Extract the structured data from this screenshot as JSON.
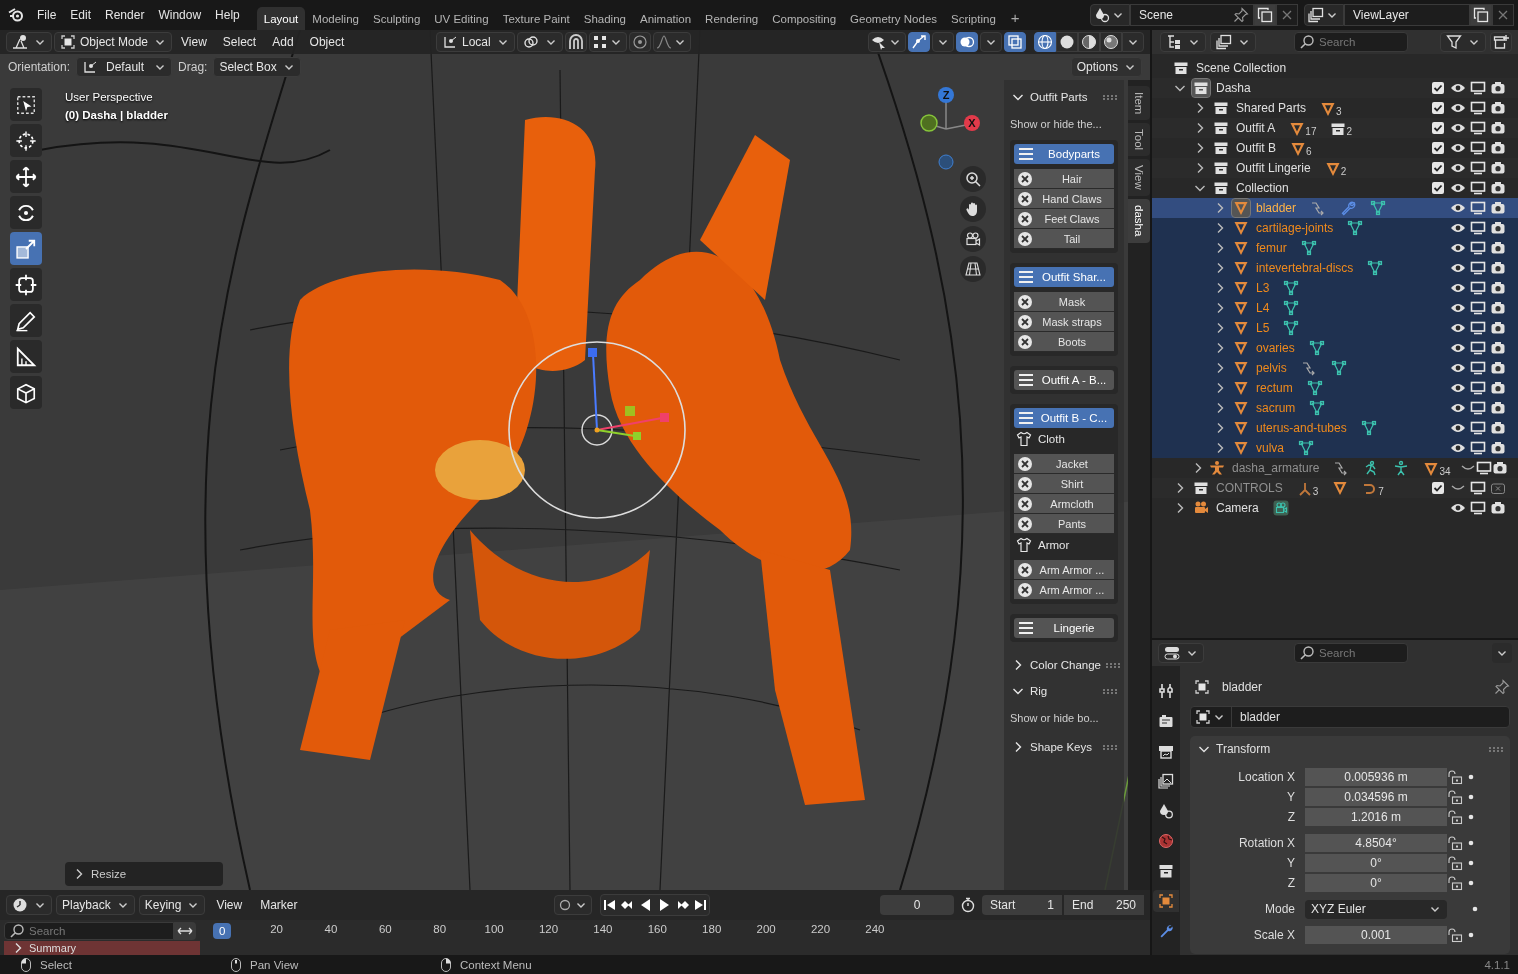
{
  "menu_bar": {
    "menus": [
      "File",
      "Edit",
      "Render",
      "Window",
      "Help"
    ],
    "workspaces": [
      {
        "label": "Layout",
        "selected": true
      },
      {
        "label": "Modeling",
        "selected": false
      },
      {
        "label": "Sculpting",
        "selected": false
      },
      {
        "label": "UV Editing",
        "selected": false
      },
      {
        "label": "Texture Paint",
        "selected": false
      },
      {
        "label": "Shading",
        "selected": false
      },
      {
        "label": "Animation",
        "selected": false
      },
      {
        "label": "Rendering",
        "selected": false
      },
      {
        "label": "Compositing",
        "selected": false
      },
      {
        "label": "Geometry Nodes",
        "selected": false
      },
      {
        "label": "Scripting",
        "selected": false
      }
    ],
    "add_workspace": "+",
    "scene": "Scene",
    "view_layer": "ViewLayer"
  },
  "viewport": {
    "header": {
      "mode": "Object Mode",
      "menus": [
        "View",
        "Select",
        "Add",
        "Object"
      ],
      "transform_orientation": "Local",
      "toggles": [
        {
          "kind": "snap",
          "on": false
        },
        {
          "kind": "proportional",
          "on": false
        },
        {
          "kind": "gizmos",
          "on": true
        },
        {
          "kind": "overlays",
          "on": true
        },
        {
          "kind": "xray",
          "on": true
        }
      ],
      "shading": [
        {
          "kind": "wireframe",
          "selected": true
        },
        {
          "kind": "solid",
          "selected": false
        },
        {
          "kind": "material",
          "selected": false
        },
        {
          "kind": "rendered",
          "selected": false
        }
      ]
    },
    "tool_settings": {
      "orientation_label": "Orientation:",
      "orientation": "Default",
      "drag_label": "Drag:",
      "drag": "Select Box",
      "options": "Options"
    },
    "tools": [
      {
        "kind": "select",
        "selected": false
      },
      {
        "kind": "cursor",
        "selected": false
      },
      {
        "kind": "move",
        "selected": false
      },
      {
        "kind": "rotate",
        "selected": false
      },
      {
        "kind": "scale",
        "selected": true
      },
      {
        "kind": "transform",
        "selected": false
      },
      {
        "kind": "annotate",
        "selected": false
      },
      {
        "kind": "measure",
        "selected": false
      },
      {
        "kind": "add_cube",
        "selected": false
      }
    ],
    "info": [
      "User Perspective",
      "(0) Dasha | bladder"
    ],
    "nav_gizmo": {
      "labels": [
        "Z",
        "X"
      ]
    },
    "last_operator": "Resize",
    "sidebar": {
      "tabs": [
        {
          "label": "Item",
          "selected": false
        },
        {
          "label": "Tool",
          "selected": false
        },
        {
          "label": "View",
          "selected": false
        },
        {
          "label": "dasha",
          "selected": true
        }
      ],
      "panels": [
        {
          "title": "Outfit Parts",
          "expanded": true,
          "description": "Show or hide the...",
          "groups": [
            {
              "header": "Bodyparts",
              "on": true,
              "items": [
                {
                  "kind": "toggle",
                  "label": "Hair"
                },
                {
                  "kind": "toggle",
                  "label": "Hand Claws"
                },
                {
                  "kind": "toggle",
                  "label": "Feet Claws"
                },
                {
                  "kind": "toggle",
                  "label": "Tail"
                }
              ]
            },
            {
              "header": "Outfit Shar...",
              "on": true,
              "items": [
                {
                  "kind": "toggle",
                  "label": "Mask"
                },
                {
                  "kind": "toggle",
                  "label": "Mask straps"
                },
                {
                  "kind": "toggle",
                  "label": "Boots"
                }
              ]
            },
            {
              "header": "Outfit A - B...",
              "on": false
            },
            {
              "header": "Outfit B - C...",
              "on": true,
              "items": [
                {
                  "kind": "heading",
                  "label": "Cloth"
                },
                {
                  "kind": "toggle",
                  "label": "Jacket"
                },
                {
                  "kind": "toggle",
                  "label": "Shirt"
                },
                {
                  "kind": "toggle",
                  "label": "Armcloth"
                },
                {
                  "kind": "toggle",
                  "label": "Pants"
                },
                {
                  "kind": "heading",
                  "label": "Armor"
                },
                {
                  "kind": "toggle",
                  "label": "Arm Armor ..."
                },
                {
                  "kind": "toggle",
                  "label": "Arm Armor ..."
                }
              ]
            },
            {
              "header": "Lingerie",
              "on": false
            }
          ]
        },
        {
          "title": "Color Change",
          "expanded": false
        },
        {
          "title": "Rig",
          "expanded": true,
          "description": "Show or hide bo..."
        },
        {
          "title": "Shape Keys",
          "expanded": false
        }
      ]
    }
  },
  "outliner": {
    "search_placeholder": "Search",
    "tree": {
      "name": "Scene Collection",
      "children": [
        {
          "name": "Dasha",
          "kind": "collection",
          "expanded": true,
          "checked": true,
          "visible": true,
          "renderable": true,
          "selected": false,
          "active": true,
          "children": [
            {
              "name": "Shared Parts",
              "kind": "collection",
              "expanded": false,
              "checked": true,
              "visible": true,
              "renderable": true,
              "selected": false,
              "active": false,
              "badges": [
                {
                  "kind": "mesh",
                  "count": "3"
                }
              ]
            },
            {
              "name": "Outfit A",
              "kind": "collection",
              "expanded": false,
              "checked": true,
              "visible": true,
              "renderable": true,
              "selected": false,
              "active": false,
              "badges": [
                {
                  "kind": "mesh",
                  "count": "17"
                },
                {
                  "kind": "collection",
                  "count": "2"
                }
              ]
            },
            {
              "name": "Outfit B",
              "kind": "collection",
              "expanded": false,
              "checked": true,
              "visible": true,
              "renderable": true,
              "selected": false,
              "active": false,
              "badges": [
                {
                  "kind": "mesh",
                  "count": "6"
                }
              ]
            },
            {
              "name": "Outfit Lingerie",
              "kind": "collection",
              "expanded": false,
              "checked": true,
              "visible": true,
              "renderable": true,
              "selected": false,
              "active": false,
              "badges": [
                {
                  "kind": "mesh",
                  "count": "2"
                }
              ]
            },
            {
              "name": "Collection",
              "kind": "collection",
              "expanded": true,
              "checked": true,
              "visible": true,
              "renderable": true,
              "selected": false,
              "active": false,
              "children": [
                {
                  "name": "bladder",
                  "kind": "mesh",
                  "expanded": false,
                  "visible": true,
                  "renderable": true,
                  "selected": true,
                  "active": true,
                  "badges": [
                    {
                      "kind": "hook"
                    },
                    {
                      "kind": "modifier"
                    },
                    {
                      "kind": "mesh_data"
                    }
                  ]
                },
                {
                  "name": "cartilage-joints",
                  "kind": "mesh",
                  "expanded": false,
                  "visible": true,
                  "renderable": true,
                  "selected": true,
                  "active": false,
                  "badges": [
                    {
                      "kind": "mesh_data"
                    }
                  ]
                },
                {
                  "name": "femur",
                  "kind": "mesh",
                  "expanded": false,
                  "visible": true,
                  "renderable": true,
                  "selected": true,
                  "active": false,
                  "badges": [
                    {
                      "kind": "mesh_data"
                    }
                  ]
                },
                {
                  "name": "intevertebral-discs",
                  "kind": "mesh",
                  "expanded": false,
                  "visible": true,
                  "renderable": true,
                  "selected": true,
                  "active": false,
                  "badges": [
                    {
                      "kind": "mesh_data"
                    }
                  ]
                },
                {
                  "name": "L3",
                  "kind": "mesh",
                  "expanded": false,
                  "visible": true,
                  "renderable": true,
                  "selected": true,
                  "active": false,
                  "badges": [
                    {
                      "kind": "mesh_data"
                    }
                  ]
                },
                {
                  "name": "L4",
                  "kind": "mesh",
                  "expanded": false,
                  "visible": true,
                  "renderable": true,
                  "selected": true,
                  "active": false,
                  "badges": [
                    {
                      "kind": "mesh_data"
                    }
                  ]
                },
                {
                  "name": "L5",
                  "kind": "mesh",
                  "expanded": false,
                  "visible": true,
                  "renderable": true,
                  "selected": true,
                  "active": false,
                  "badges": [
                    {
                      "kind": "mesh_data"
                    }
                  ]
                },
                {
                  "name": "ovaries",
                  "kind": "mesh",
                  "expanded": false,
                  "visible": true,
                  "renderable": true,
                  "selected": true,
                  "active": false,
                  "badges": [
                    {
                      "kind": "mesh_data"
                    }
                  ]
                },
                {
                  "name": "pelvis",
                  "kind": "mesh",
                  "expanded": false,
                  "visible": true,
                  "renderable": true,
                  "selected": true,
                  "active": false,
                  "badges": [
                    {
                      "kind": "hook"
                    },
                    {
                      "kind": "mesh_data"
                    }
                  ]
                },
                {
                  "name": "rectum",
                  "kind": "mesh",
                  "expanded": false,
                  "visible": true,
                  "renderable": true,
                  "selected": true,
                  "active": false,
                  "badges": [
                    {
                      "kind": "mesh_data"
                    }
                  ]
                },
                {
                  "name": "sacrum",
                  "kind": "mesh",
                  "expanded": false,
                  "visible": true,
                  "renderable": true,
                  "selected": true,
                  "active": false,
                  "badges": [
                    {
                      "kind": "mesh_data"
                    }
                  ]
                },
                {
                  "name": "uterus-and-tubes",
                  "kind": "mesh",
                  "expanded": false,
                  "visible": true,
                  "renderable": true,
                  "selected": true,
                  "active": false,
                  "badges": [
                    {
                      "kind": "mesh_data"
                    }
                  ]
                },
                {
                  "name": "vulva",
                  "kind": "mesh",
                  "expanded": false,
                  "visible": true,
                  "renderable": true,
                  "selected": true,
                  "active": false,
                  "badges": [
                    {
                      "kind": "mesh_data"
                    }
                  ]
                }
              ]
            },
            {
              "name": "dasha_armature",
              "kind": "armature",
              "expanded": false,
              "visible": false,
              "renderable": true,
              "selected": false,
              "active": false,
              "badges": [
                {
                  "kind": "hook"
                },
                {
                  "kind": "pose"
                },
                {
                  "kind": "armature_data"
                },
                {
                  "kind": "mesh",
                  "count": "34"
                }
              ]
            }
          ]
        },
        {
          "name": "CONTROLS",
          "kind": "collection",
          "expanded": false,
          "checked": true,
          "visible": false,
          "renderable": false,
          "selected": false,
          "active": false,
          "badges": [
            {
              "kind": "empty",
              "count": "3"
            },
            {
              "kind": "mesh"
            },
            {
              "kind": "curve",
              "count": "7"
            }
          ]
        },
        {
          "name": "Camera",
          "kind": "camera",
          "expanded": false,
          "visible": true,
          "renderable": true,
          "selected": false,
          "active": false,
          "badges": [
            {
              "kind": "camera_data"
            }
          ]
        }
      ]
    }
  },
  "properties": {
    "search_placeholder": "Search",
    "tabs": [
      {
        "kind": "tool",
        "selected": false
      },
      {
        "kind": "render",
        "selected": false
      },
      {
        "kind": "output",
        "selected": false
      },
      {
        "kind": "view_layer",
        "selected": false
      },
      {
        "kind": "scene",
        "selected": false
      },
      {
        "kind": "world",
        "selected": false
      },
      {
        "kind": "collection",
        "selected": false
      },
      {
        "kind": "object",
        "selected": true
      },
      {
        "kind": "modifiers",
        "selected": false
      }
    ],
    "object_name": "bladder",
    "datablock": "bladder",
    "panel": {
      "title": "Transform",
      "expanded": true,
      "groups": [
        {
          "rows": [
            {
              "kind": "number",
              "label": "Location X",
              "value": "0.005936 m"
            },
            {
              "kind": "number",
              "label": "Y",
              "value": "0.034596 m"
            },
            {
              "kind": "number",
              "label": "Z",
              "value": "1.2016 m"
            }
          ]
        },
        {
          "rows": [
            {
              "kind": "number",
              "label": "Rotation X",
              "value": "4.8504°"
            },
            {
              "kind": "number",
              "label": "Y",
              "value": "0°"
            },
            {
              "kind": "number",
              "label": "Z",
              "value": "0°"
            }
          ]
        },
        {
          "rows": [
            {
              "kind": "dropdown",
              "label": "Mode",
              "value": "XYZ Euler"
            }
          ]
        },
        {
          "rows": [
            {
              "kind": "number",
              "label": "Scale X",
              "value": "0.001"
            }
          ]
        }
      ]
    }
  },
  "timeline": {
    "menus": [
      {
        "kind": "dropdown",
        "label": "Playback"
      },
      {
        "kind": "dropdown",
        "label": "Keying"
      },
      {
        "kind": "plain",
        "label": "View"
      },
      {
        "kind": "plain",
        "label": "Marker"
      }
    ],
    "auto_key": false,
    "current_frame": "0",
    "start_label": "Start",
    "start": "1",
    "end_label": "End",
    "end": "250",
    "search_placeholder": "Search",
    "ruler": {
      "current": "0",
      "ticks": [
        "20",
        "40",
        "60",
        "80",
        "100",
        "120",
        "140",
        "160",
        "180",
        "200",
        "220",
        "240"
      ]
    },
    "channels": [
      "Summary"
    ]
  },
  "status_bar": {
    "items": [
      {
        "kind": "left_mouse",
        "label": "Select"
      },
      {
        "kind": "middle_mouse",
        "label": "Pan View"
      },
      {
        "kind": "right_mouse",
        "label": "Context Menu"
      }
    ],
    "version": "4.1.1"
  }
}
